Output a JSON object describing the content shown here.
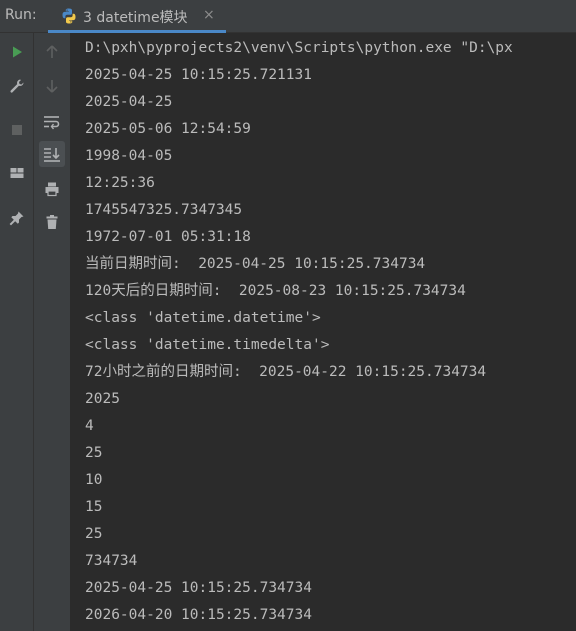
{
  "header": {
    "run_label": "Run:",
    "tab": {
      "label": "3 datetime模块",
      "close": "×",
      "icon": "python-icon"
    }
  },
  "toolbar_left": [
    {
      "name": "rerun-icon",
      "color": "#499c54"
    },
    {
      "name": "wrench-icon",
      "color": "#afb1b3"
    },
    {
      "name": "stop-icon",
      "color": "#5e6060"
    },
    {
      "name": "layout-icon",
      "color": "#afb1b3"
    },
    {
      "name": "pin-icon",
      "color": "#afb1b3"
    }
  ],
  "toolbar_right": [
    {
      "name": "arrow-up-icon"
    },
    {
      "name": "arrow-down-icon"
    },
    {
      "name": "soft-wrap-icon"
    },
    {
      "name": "scroll-to-end-icon"
    },
    {
      "name": "print-icon"
    },
    {
      "name": "trash-icon"
    }
  ],
  "console": {
    "lines": [
      "D:\\pxh\\pyprojects2\\venv\\Scripts\\python.exe \"D:\\px",
      "2025-04-25 10:15:25.721131",
      "2025-04-25",
      "2025-05-06 12:54:59",
      "1998-04-05",
      "12:25:36",
      "1745547325.7347345",
      "1972-07-01 05:31:18",
      "当前日期时间:  2025-04-25 10:15:25.734734",
      "120天后的日期时间:  2025-08-23 10:15:25.734734",
      "<class 'datetime.datetime'>",
      "<class 'datetime.timedelta'>",
      "72小时之前的日期时间:  2025-04-22 10:15:25.734734",
      "2025",
      "4",
      "25",
      "10",
      "15",
      "25",
      "734734",
      "2025-04-25 10:15:25.734734",
      "2026-04-20 10:15:25.734734"
    ]
  }
}
